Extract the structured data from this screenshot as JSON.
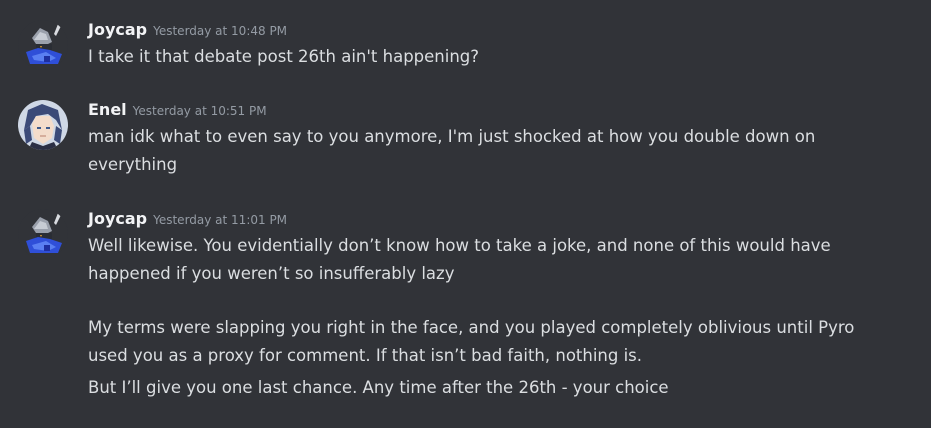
{
  "messages": [
    {
      "author": "Joycap",
      "timestamp": "Yesterday at 10:48 PM",
      "lines": [
        "I take it that debate post 26th ain't happening?"
      ]
    },
    {
      "author": "Enel",
      "timestamp": "Yesterday at 10:51 PM",
      "lines": [
        "man idk what to even say to you anymore, I'm just shocked at how you double down on",
        "everything"
      ]
    },
    {
      "author": "Joycap",
      "timestamp": "Yesterday at 11:01 PM",
      "lines": [
        "Well likewise. You evidentially don’t know how to take a joke, and none of this would have",
        "happened if you weren’t so insufferably lazy",
        "My terms were slapping you right in the face, and you played completely oblivious until Pyro",
        "used you as a proxy for comment. If that isn’t bad faith, nothing is.",
        "But I’ll give you one last chance. Any time after the 26th - your choice"
      ]
    }
  ],
  "colors": {
    "background": "#313338",
    "username": "#f2f3f5",
    "timestamp": "#949ba4",
    "message_text": "#dbdee1"
  },
  "icons": {
    "joycap_avatar": "penguin-knight-pixel-avatar",
    "enel_avatar": "anime-character-avatar"
  }
}
